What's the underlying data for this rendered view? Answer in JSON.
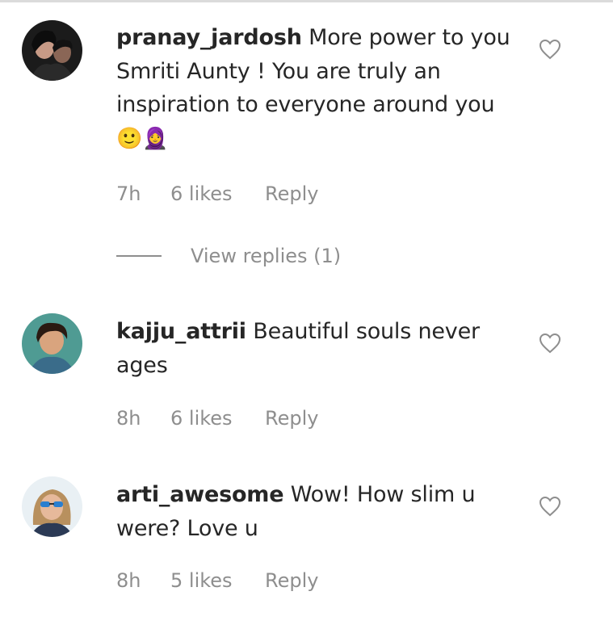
{
  "comments": [
    {
      "username": "pranay_jardosh",
      "text": " More power to you Smriti Aunty ! You are truly an inspiration to everyone around you ",
      "emojis": "🙂🧕",
      "time": "7h",
      "likes": "6 likes",
      "reply": "Reply",
      "avatar": "avatar-photo-couple"
    },
    {
      "username": "kajju_attrii",
      "text": " Beautiful souls never ages",
      "time": "8h",
      "likes": "6 likes",
      "reply": "Reply",
      "avatar": "avatar-photo-woman"
    },
    {
      "username": "arti_awesome",
      "text": " Wow! How slim u were? Love u",
      "time": "8h",
      "likes": "5 likes",
      "reply": "Reply",
      "avatar": "avatar-photo-sunglasses"
    }
  ],
  "view_replies": "View replies (1)",
  "colors": {
    "text": "#262626",
    "secondary": "#8e8e8e",
    "border": "#dbdbdb"
  },
  "icons": {
    "like": "heart-outline-icon"
  }
}
